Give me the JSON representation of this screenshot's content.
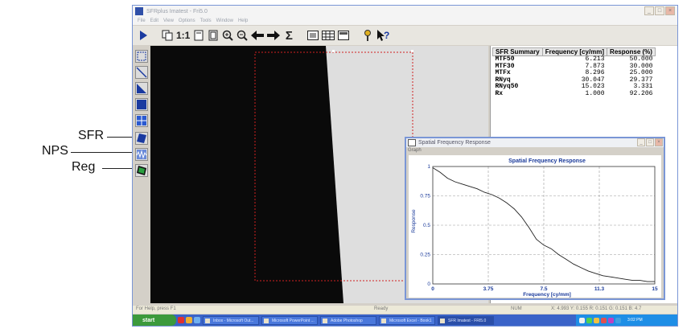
{
  "callouts": {
    "sfr": "SFR",
    "nps": "NPS",
    "reg": "Reg"
  },
  "window": {
    "title": "SFRplus Imatest - Fri5.0",
    "minimize": "_",
    "maximize": "□",
    "close": "×"
  },
  "menu": [
    "File",
    "Edit",
    "View",
    "Options",
    "Tools",
    "Window",
    "Help"
  ],
  "toolbar": {
    "zoom_one_to_one": "1:1",
    "sum": "Σ"
  },
  "icons": {
    "play": "play-icon",
    "copy": "copy-icon",
    "fit": "fit-page-icon",
    "zoom_in": "zoom-in-icon",
    "zoom_out": "zoom-out-icon",
    "back": "arrow-left-icon",
    "forward": "arrow-right-icon",
    "help": "help-icon",
    "key": "key-icon"
  },
  "colors": {
    "accent_red": "#d02020",
    "plot_line": "#202020",
    "title_blue": "#1a3a9a"
  },
  "sfr_summary": {
    "headers": [
      "SFR Summary",
      "Frequency [cy/mm]",
      "Response (%)"
    ],
    "rows": [
      {
        "metric": "MTF50",
        "frequency": "6.213",
        "response": "50.000"
      },
      {
        "metric": "MTF30",
        "frequency": "7.873",
        "response": "30.000"
      },
      {
        "metric": "MTFx",
        "frequency": "8.296",
        "response": "25.000"
      },
      {
        "metric": "RNyq",
        "frequency": "30.047",
        "response": "29.377"
      },
      {
        "metric": "RNyq50",
        "frequency": "15.023",
        "response": "3.331"
      },
      {
        "metric": "Rx",
        "frequency": "1.000",
        "response": "92.206"
      }
    ]
  },
  "dialog": {
    "title": "Spatial Frequency Response",
    "menu_label": "Graph"
  },
  "chart_data": {
    "type": "line",
    "title": "Spatial Frequency Response",
    "xlabel": "Frequency [cy/mm]",
    "ylabel": "Response",
    "xlim": [
      0,
      15
    ],
    "ylim": [
      0,
      1
    ],
    "x_ticks": [
      "0",
      "3.75",
      "7.5",
      "11.3",
      "15"
    ],
    "y_ticks": [
      "0",
      "0.25",
      "0.5",
      "0.75",
      "1"
    ],
    "grid": true,
    "series": [
      {
        "x": [
          0,
          0.5,
          1,
          1.5,
          2,
          2.5,
          3,
          3.5,
          4,
          4.5,
          5,
          5.5,
          6,
          6.5,
          7,
          7.5,
          8,
          8.5,
          9,
          9.5,
          10,
          10.5,
          11,
          11.5,
          12,
          12.5,
          13,
          13.5,
          14,
          14.5,
          15
        ],
        "y": [
          0.99,
          0.95,
          0.9,
          0.87,
          0.85,
          0.83,
          0.81,
          0.78,
          0.76,
          0.73,
          0.69,
          0.64,
          0.57,
          0.48,
          0.38,
          0.33,
          0.3,
          0.25,
          0.21,
          0.17,
          0.14,
          0.11,
          0.09,
          0.07,
          0.06,
          0.05,
          0.04,
          0.03,
          0.03,
          0.02,
          0.02
        ]
      }
    ]
  },
  "status": {
    "left": "For Help, press F1",
    "mid": "Ready",
    "right": "NUM",
    "coords": "X: 4.993 Y: 0.155 R: 0.151 G: 0.151 B: 4.7"
  },
  "taskbar": {
    "start": "start",
    "tasks": [
      "Inbox - Microsoft Out...",
      "Microsoft PowerPoint ...",
      "Adobe Photoshop",
      "Microsoft Excel - Book1",
      "SFR Imatest - FRI5.0"
    ],
    "clock": "3:02 PM"
  }
}
